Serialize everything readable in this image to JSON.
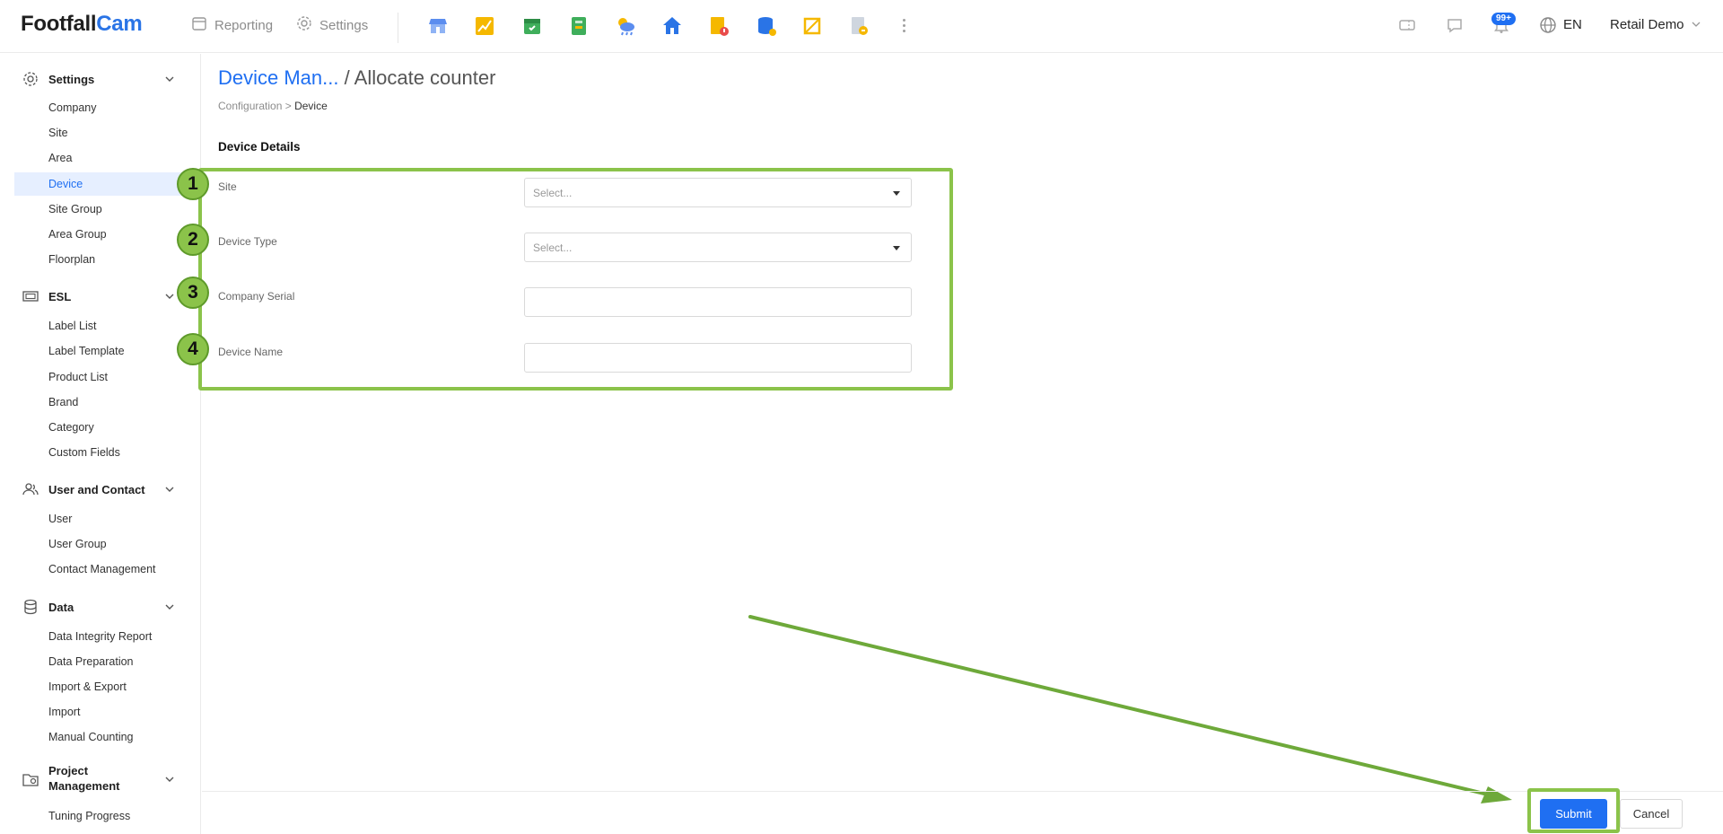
{
  "brand": {
    "part1": "Footfall",
    "part2": "Cam"
  },
  "topnav": {
    "reporting": "Reporting",
    "settings": "Settings",
    "apps": [
      "store-app-icon",
      "chart-app-icon",
      "calendar-app-icon",
      "ledger-app-icon",
      "weather-app-icon",
      "home-app-icon",
      "alert-doc-app-icon",
      "database-app-icon",
      "crop-app-icon",
      "file-export-app-icon"
    ],
    "notification_badge": "99+",
    "language": "EN",
    "user": "Retail Demo"
  },
  "sidebar": {
    "settings": {
      "title": "Settings",
      "items": [
        "Company",
        "Site",
        "Area",
        "Device",
        "Site Group",
        "Area Group",
        "Floorplan"
      ]
    },
    "esl": {
      "title": "ESL",
      "items": [
        "Label List",
        "Label Template",
        "Product List",
        "Brand",
        "Category",
        "Custom Fields"
      ]
    },
    "user_contact": {
      "title": "User and Contact",
      "items": [
        "User",
        "User Group",
        "Contact Management"
      ]
    },
    "data": {
      "title": "Data",
      "items": [
        "Data Integrity Report",
        "Data Preparation",
        "Import & Export",
        "Import",
        "Manual Counting"
      ]
    },
    "project": {
      "title_line1": "Project",
      "title_line2": "Management",
      "items": [
        "Tuning Progress"
      ]
    },
    "active_item": "Device"
  },
  "page": {
    "title_link": "Device Man...",
    "title_sep": "/",
    "title_current": "Allocate counter",
    "breadcrumb_parent": "Configuration",
    "breadcrumb_sep": ">",
    "breadcrumb_current": "Device",
    "section_title": "Device Details"
  },
  "form": {
    "fields": [
      {
        "num": "1",
        "label": "Site",
        "type": "select",
        "placeholder": "Select..."
      },
      {
        "num": "2",
        "label": "Device Type",
        "type": "select",
        "placeholder": "Select..."
      },
      {
        "num": "3",
        "label": "Company Serial",
        "type": "text",
        "value": ""
      },
      {
        "num": "4",
        "label": "Device Name",
        "type": "text",
        "value": ""
      }
    ]
  },
  "actions": {
    "submit": "Submit",
    "cancel": "Cancel"
  },
  "colors": {
    "accent": "#1f6ff2",
    "annotation_green": "#8bc34a"
  }
}
